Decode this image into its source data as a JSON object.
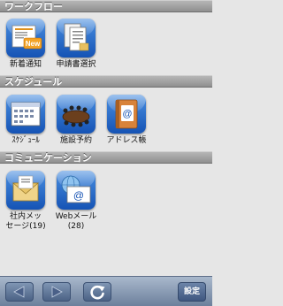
{
  "sections": [
    {
      "title": "ワークフロー",
      "apps": [
        {
          "label": "新着通知",
          "icon": "new-notification-icon",
          "badge": "New"
        },
        {
          "label": "申請書選択",
          "icon": "form-select-icon"
        }
      ]
    },
    {
      "title": "スケジュール",
      "apps": [
        {
          "label": "ｽｹｼﾞｭｰﾙ",
          "icon": "calendar-icon"
        },
        {
          "label": "施設予約",
          "icon": "meeting-room-icon"
        },
        {
          "label": "アドレス帳",
          "icon": "address-book-icon"
        }
      ]
    },
    {
      "title": "コミュニケーション",
      "apps": [
        {
          "label": "社内メッ\nセージ(19)",
          "icon": "internal-message-icon"
        },
        {
          "label": "Webメール\n(28)",
          "icon": "webmail-icon"
        }
      ]
    }
  ],
  "toolbar": {
    "back_icon": "back-arrow-icon",
    "forward_icon": "forward-arrow-icon",
    "refresh_icon": "refresh-icon",
    "settings_label": "設定"
  }
}
